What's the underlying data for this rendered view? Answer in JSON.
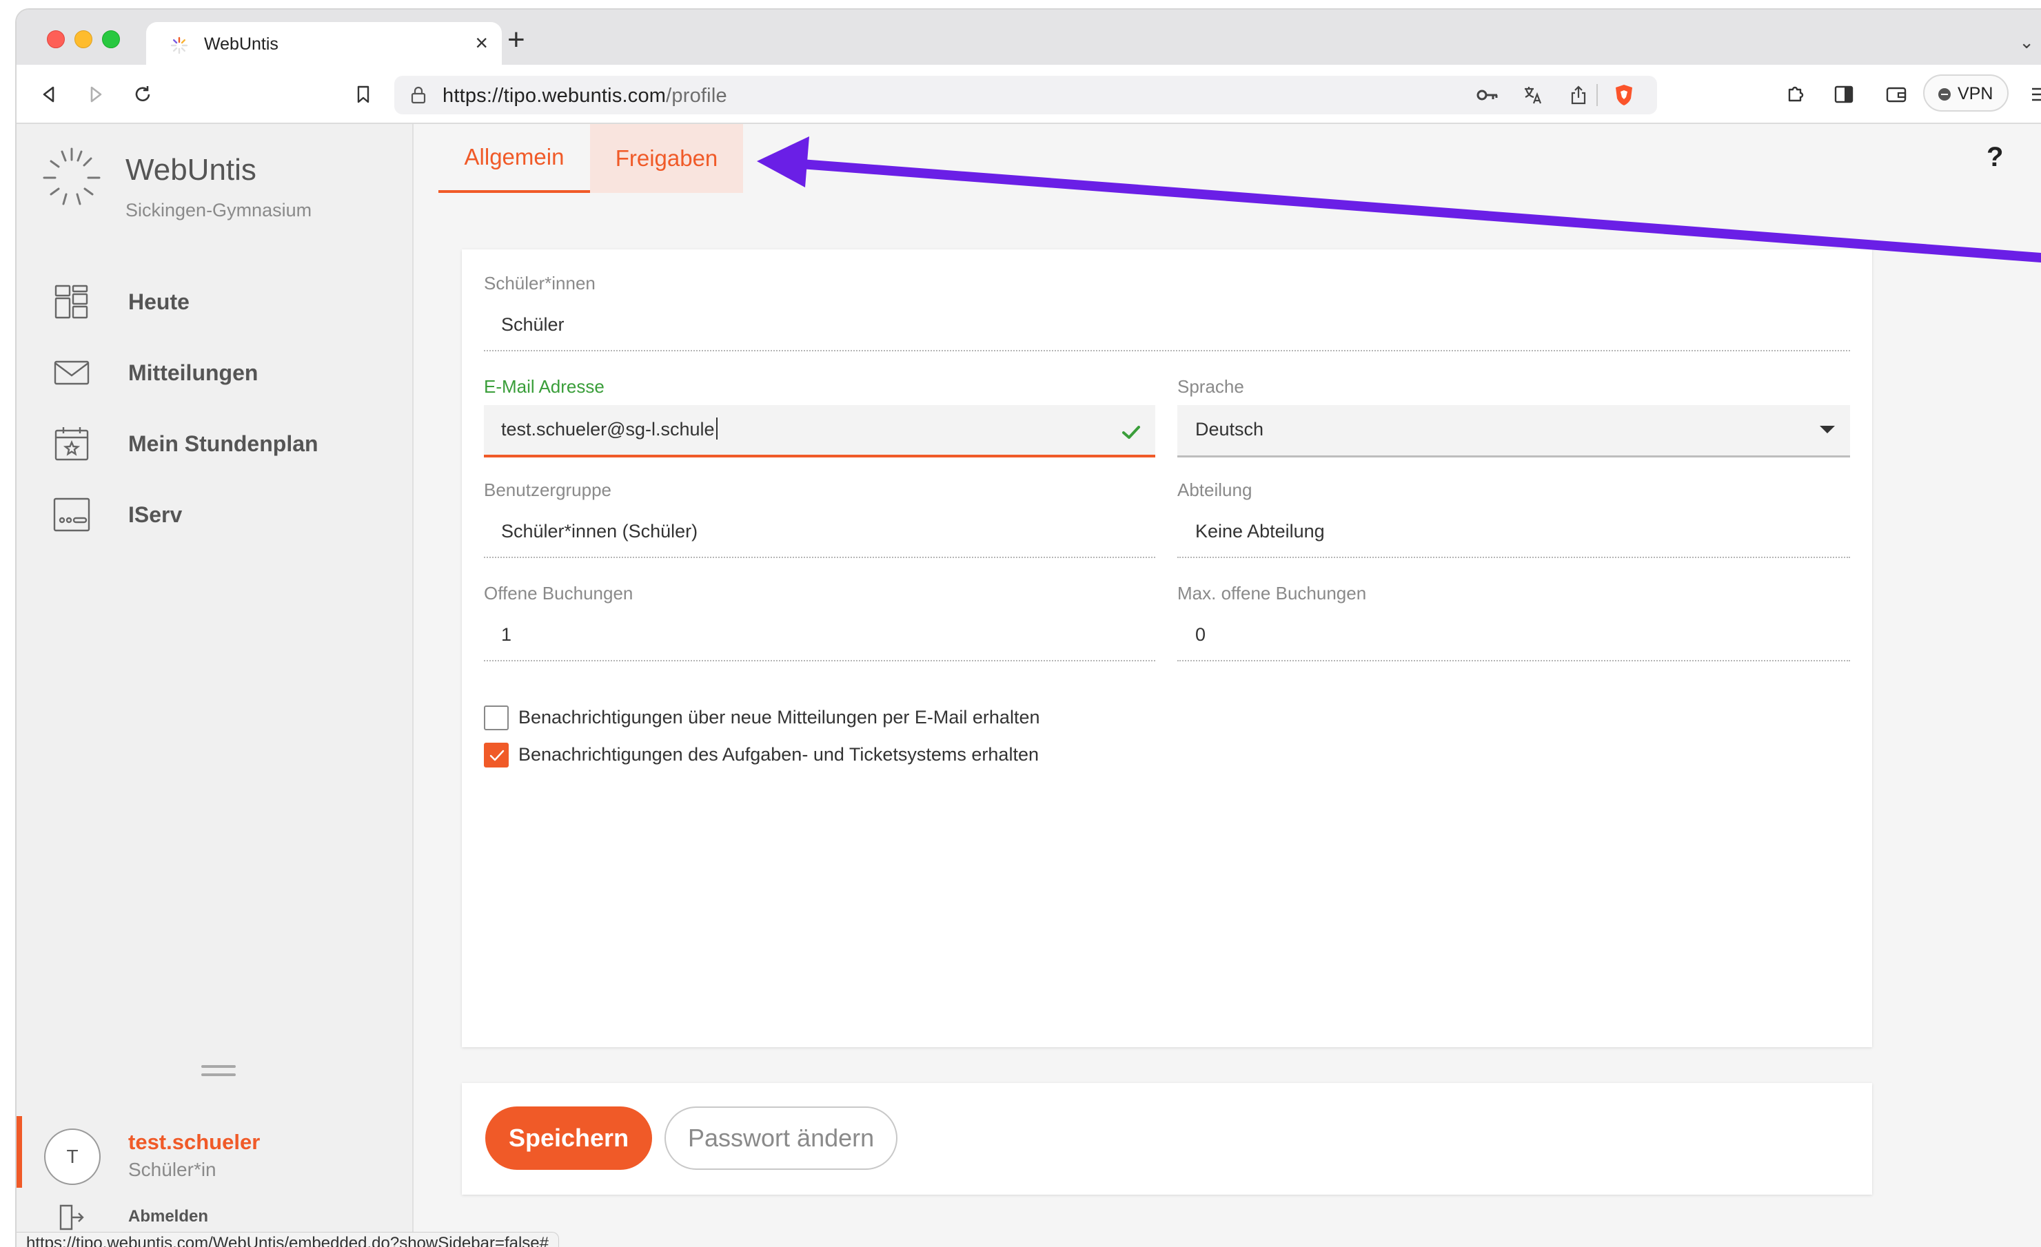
{
  "browser": {
    "tab_title": "WebUntis",
    "url_host": "https://tipo.webuntis.com",
    "url_path": "/profile",
    "vpn_label": "VPN",
    "status_url": "https://tipo.webuntis.com/WebUntis/embedded.do?showSidebar=false#"
  },
  "sidebar": {
    "brand": "WebUntis",
    "school": "Sickingen-Gymnasium",
    "items": [
      {
        "label": "Heute",
        "icon": "dashboard-icon"
      },
      {
        "label": "Mitteilungen",
        "icon": "envelope-icon"
      },
      {
        "label": "Mein Stundenplan",
        "icon": "calendar-star-icon"
      },
      {
        "label": "IServ",
        "icon": "iserv-icon"
      }
    ],
    "user": {
      "initial": "T",
      "name": "test.schueler",
      "role": "Schüler*in",
      "logout": "Abmelden"
    }
  },
  "profile": {
    "tabs": [
      "Allgemein",
      "Freigaben"
    ],
    "help": "?",
    "fields": {
      "student_label": "Schüler*innen",
      "student_value": "Schüler",
      "email_label": "E-Mail Adresse",
      "email_value": "test.schueler@sg-l.schule",
      "language_label": "Sprache",
      "language_value": "Deutsch",
      "group_label": "Benutzergruppe",
      "group_value": "Schüler*innen (Schüler)",
      "department_label": "Abteilung",
      "department_value": "Keine Abteilung",
      "open_bookings_label": "Offene Buchungen",
      "open_bookings_value": "1",
      "max_bookings_label": "Max. offene Buchungen",
      "max_bookings_value": "0"
    },
    "checkboxes": [
      {
        "label": "Benachrichtigungen über neue Mitteilungen per E-Mail erhalten",
        "checked": false
      },
      {
        "label": "Benachrichtigungen des Aufgaben- und Ticketsystems erhalten",
        "checked": true
      }
    ],
    "actions": {
      "save": "Speichern",
      "change_password": "Passwort ändern"
    }
  },
  "colors": {
    "accent": "#f05a28",
    "success": "#3a9e3a",
    "annotation": "#6a1fe6"
  }
}
